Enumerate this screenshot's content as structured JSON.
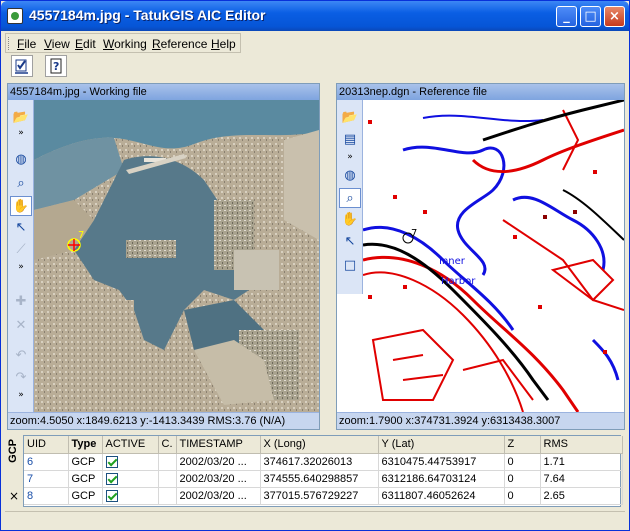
{
  "window": {
    "title": "4557184m.jpg - TatukGIS AIC Editor"
  },
  "title_buttons": {
    "minimize": "_",
    "maximize": "□",
    "close": "×"
  },
  "menu": [
    {
      "label": "File",
      "accel": "F",
      "rest": "ile"
    },
    {
      "label": "View",
      "accel": "V",
      "rest": "iew"
    },
    {
      "label": "Edit",
      "accel": "E",
      "rest": "dit"
    },
    {
      "label": "Working",
      "accel": "W",
      "rest": "orking"
    },
    {
      "label": "Reference",
      "accel": "R",
      "rest": "eference"
    },
    {
      "label": "Help",
      "accel": "H",
      "rest": "elp"
    }
  ],
  "working_panel": {
    "header": "4557184m.jpg - Working file",
    "status": "zoom:4.5050 x:1849.6213 y:-1413.3439 RMS:3.76 (N/A)",
    "marker_label": "7"
  },
  "reference_panel": {
    "header": "20313nep.dgn - Reference file",
    "status": "zoom:1.7900 x:374731.3924 y:6313438.3007",
    "marker_label": "7",
    "map_text": [
      "Inner",
      "Harbor"
    ]
  },
  "gcp": {
    "side_label": "GCP",
    "close_label": "×",
    "columns": [
      "UID",
      "Type",
      "ACTIVE",
      "C.",
      "TIMESTAMP",
      "X (Long)",
      "Y (Lat)",
      "Z",
      "RMS"
    ],
    "rows": [
      {
        "uid": "6",
        "type": "GCP",
        "active": true,
        "c": "",
        "timestamp": "2002/03/20 ...",
        "x": "374617.32026013",
        "y": "6310475.44753917",
        "z": "0",
        "rms": "1.71"
      },
      {
        "uid": "7",
        "type": "GCP",
        "active": true,
        "c": "",
        "timestamp": "2002/03/20 ...",
        "x": "374555.640298857",
        "y": "6312186.64703124",
        "z": "0",
        "rms": "7.64"
      },
      {
        "uid": "8",
        "type": "GCP",
        "active": true,
        "c": "",
        "timestamp": "2002/03/20 ...",
        "x": "377015.576729227",
        "y": "6311807.46052624",
        "z": "0",
        "rms": "2.65"
      }
    ]
  },
  "colors": {
    "title_blue": "#0a5ee4",
    "panel_header": "#7ea4df",
    "map_red": "#e00000",
    "map_blue": "#1010e0",
    "map_black": "#000000"
  }
}
